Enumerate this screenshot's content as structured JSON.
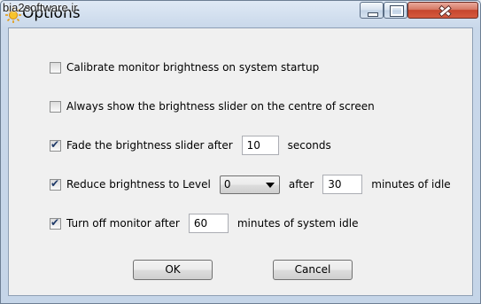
{
  "window": {
    "title": "Options",
    "watermark": "bia2software.ir",
    "app_icon": "sun-icon",
    "controls": [
      "minimize-icon",
      "maximize-icon",
      "close-icon"
    ]
  },
  "options": {
    "calibrate": {
      "label": "Calibrate monitor brightness on system startup",
      "checked": false
    },
    "always_show": {
      "label": "Always show the brightness slider on the centre of screen",
      "checked": false
    },
    "fade": {
      "label": "Fade the brightness slider after",
      "checked": true,
      "value": "10",
      "suffix": "seconds"
    },
    "reduce": {
      "label": "Reduce brightness to Level",
      "checked": true,
      "level": "0",
      "after_label": "after",
      "value": "30",
      "suffix": "minutes of idle"
    },
    "turn_off": {
      "label": "Turn off monitor after",
      "checked": true,
      "value": "60",
      "suffix": "minutes of system idle"
    }
  },
  "buttons": {
    "ok": "OK",
    "cancel": "Cancel"
  },
  "colors": {
    "titlebar": "#c9d8ea",
    "close_button": "#c6462e",
    "client_bg": "#f0f0f0"
  }
}
